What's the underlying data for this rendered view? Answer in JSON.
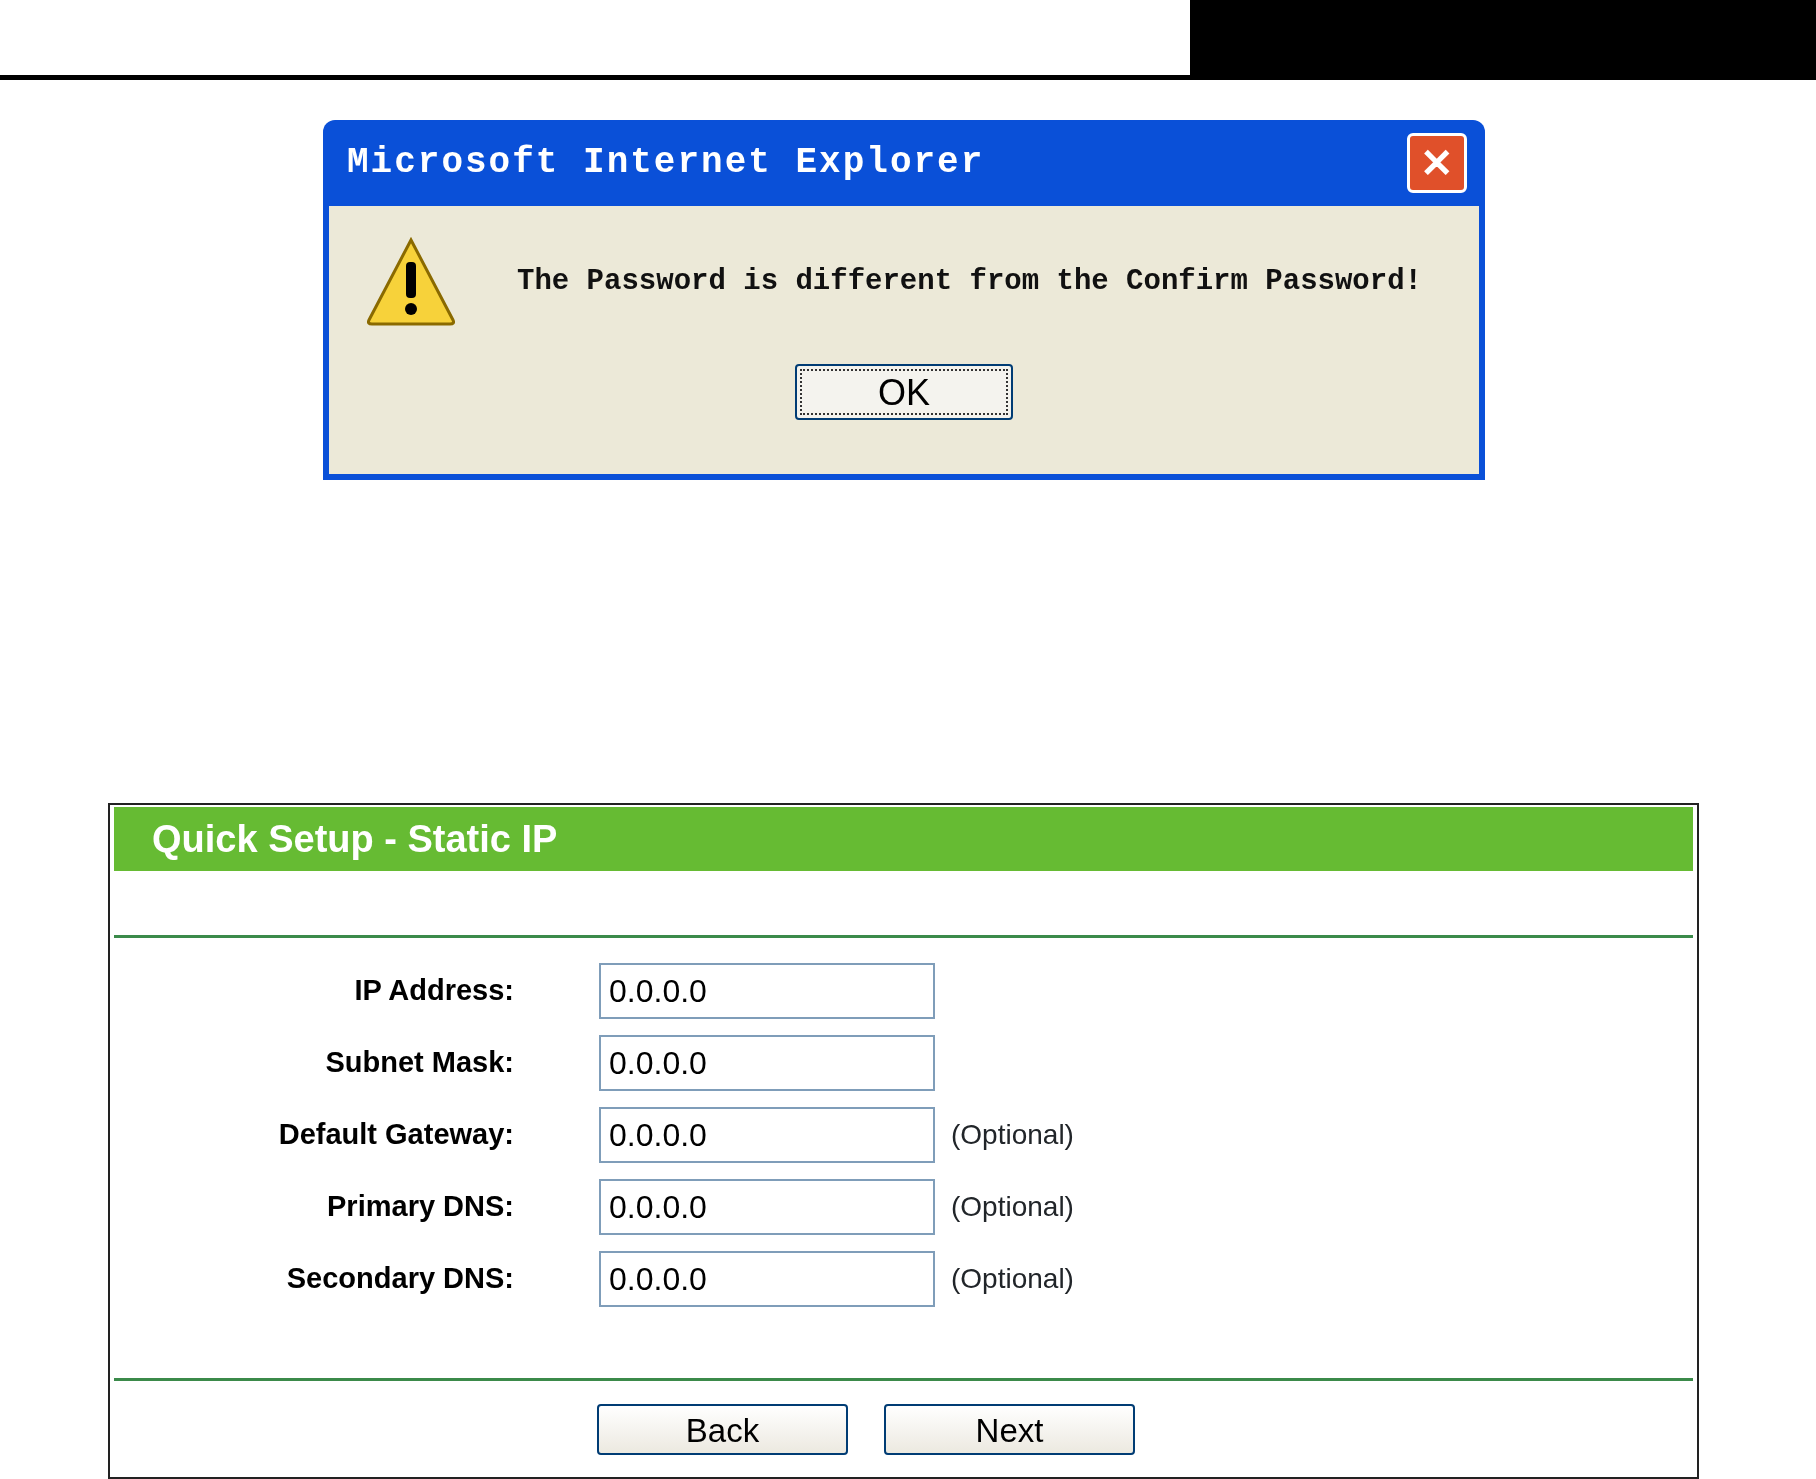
{
  "dialog": {
    "title": "Microsoft Internet Explorer",
    "close": "✕",
    "message": "The Password is different from the Confirm Password!",
    "buttons": [
      "OK"
    ]
  },
  "setup": {
    "title": "Quick Setup - Static IP",
    "fields": [
      {
        "label": "IP Address:",
        "value": "0.0.0.0"
      },
      {
        "label": "Subnet Mask:",
        "value": "0.0.0.0"
      },
      {
        "label": "Default Gateway:",
        "value": "0.0.0.0",
        "note": "(Optional)"
      },
      {
        "label": "Primary DNS:",
        "value": "0.0.0.0",
        "note": "(Optional)"
      },
      {
        "label": "Secondary DNS:",
        "value": "0.0.0.0",
        "note": "(Optional)"
      }
    ],
    "buttons": [
      "Back",
      "Next"
    ]
  }
}
